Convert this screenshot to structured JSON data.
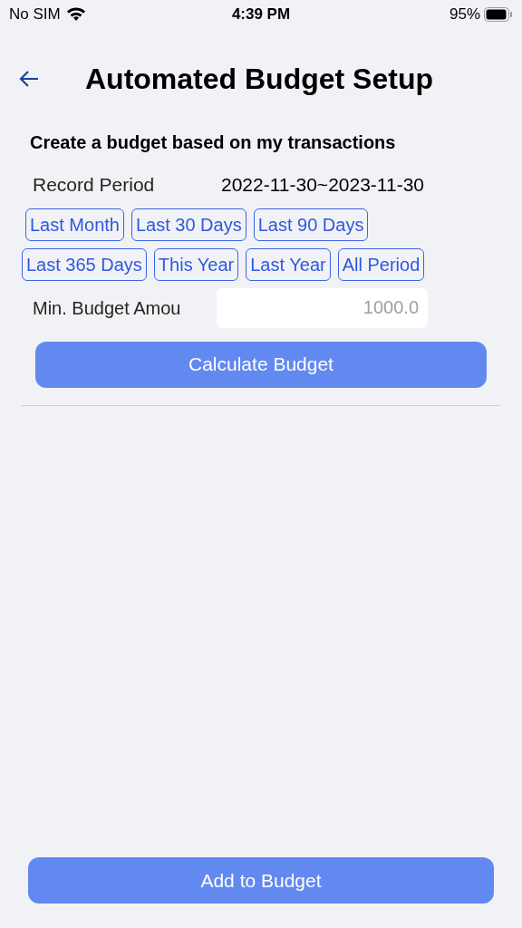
{
  "status_bar": {
    "carrier": "No SIM",
    "time": "4:39 PM",
    "battery": "95%"
  },
  "header": {
    "title": "Automated Budget Setup"
  },
  "section_title": "Create a budget based on my transactions",
  "record_period": {
    "label": "Record Period",
    "value": "2022-11-30~2023-11-30"
  },
  "period_rows": [
    [
      "Last Month",
      "Last 30 Days",
      "Last 90 Days"
    ],
    [
      "Last 365 Days",
      "This Year",
      "Last Year",
      "All Period"
    ]
  ],
  "min_budget": {
    "label": "Min. Budget Amou",
    "placeholder": "1000.0"
  },
  "calculate_button": "Calculate Budget",
  "add_button": "Add to Budget"
}
